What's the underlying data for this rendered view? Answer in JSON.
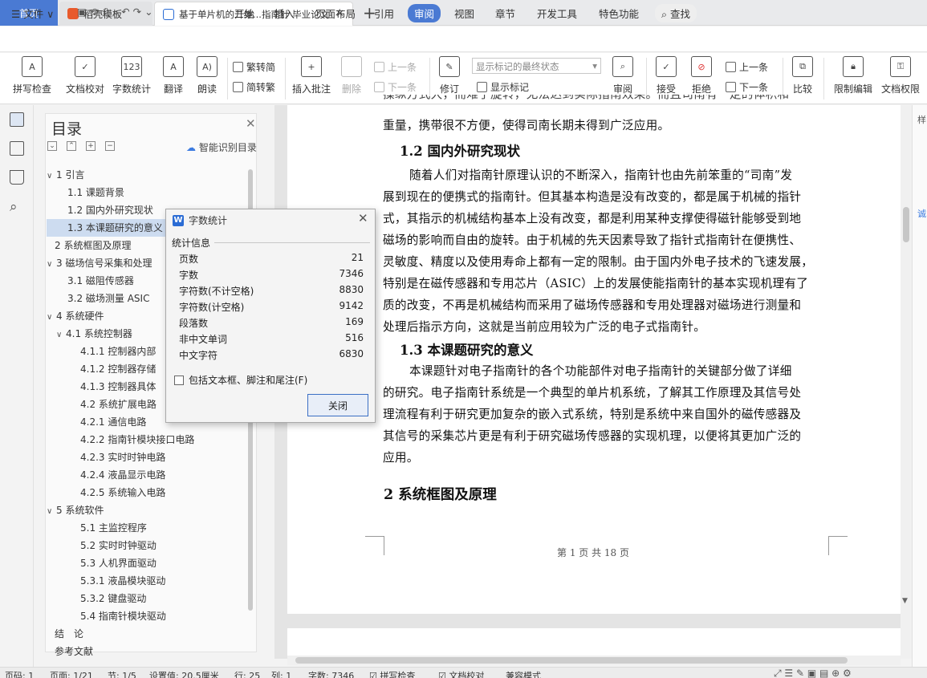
{
  "tabs": {
    "home": "首页",
    "template": "稻壳模板",
    "document": "基于单片机的二维...指南针 毕业论文"
  },
  "menu": {
    "file": "文件",
    "items": [
      "开始",
      "插入",
      "页面布局",
      "引用",
      "审阅",
      "视图",
      "章节",
      "开发工具",
      "特色功能"
    ],
    "active": "审阅",
    "search": "查找"
  },
  "ribbon": {
    "spellcheck": "拼写检查",
    "doc_proof": "文档校对",
    "word_count": "字数统计",
    "translate": "翻译",
    "read_aloud": "朗读",
    "trad_to_simp": "繁转简",
    "simp_to_trad": "简转繁",
    "insert_comment": "插入批注",
    "delete": "删除",
    "prev": "上一条",
    "next": "下一条",
    "revise": "修订",
    "markup_select": "显示标记的最终状态",
    "show_markup": "显示标记",
    "review": "审阅",
    "accept": "接受",
    "reject": "拒绝",
    "prev2": "上一条",
    "next2": "下一条",
    "compare": "比较",
    "restrict_edit": "限制编辑",
    "doc_perm": "文档权限"
  },
  "toc": {
    "title": "目录",
    "smart": "智能识别目录",
    "items": [
      {
        "text": "1 引言",
        "level": 1,
        "toggle": "∨"
      },
      {
        "text": "1.1 课题背景",
        "level": 2
      },
      {
        "text": "1.2 国内外研究现状",
        "level": 2
      },
      {
        "text": "1.3 本课题研究的意义",
        "level": 2,
        "selected": true
      },
      {
        "text": "2 系统框图及原理",
        "level": 1
      },
      {
        "text": "3 磁场信号采集和处理",
        "level": 1,
        "toggle": "∨"
      },
      {
        "text": "3.1 磁阻传感器",
        "level": 2
      },
      {
        "text": "3.2 磁场测量 ASIC",
        "level": 2
      },
      {
        "text": "4 系统硬件",
        "level": 1,
        "toggle": "∨"
      },
      {
        "text": "4.1 系统控制器",
        "level": 2,
        "toggle": "∨"
      },
      {
        "text": "4.1.1 控制器内部",
        "level": 3
      },
      {
        "text": "4.1.2 控制器存储",
        "level": 3
      },
      {
        "text": "4.1.3 控制器具体",
        "level": 3
      },
      {
        "text": "4.2 系统扩展电路",
        "level": 3
      },
      {
        "text": "4.2.1 通信电路",
        "level": 3
      },
      {
        "text": "4.2.2 指南针模块接口电路",
        "level": 3
      },
      {
        "text": "4.2.3 实时时钟电路",
        "level": 3
      },
      {
        "text": "4.2.4 液晶显示电路",
        "level": 3
      },
      {
        "text": "4.2.5 系统输入电路",
        "level": 3
      },
      {
        "text": "5 系统软件",
        "level": 1,
        "toggle": "∨"
      },
      {
        "text": "5.1 主监控程序",
        "level": 3
      },
      {
        "text": "5.2 实时时钟驱动",
        "level": 3
      },
      {
        "text": "5.3 人机界面驱动",
        "level": 3
      },
      {
        "text": "5.3.1 液晶模块驱动",
        "level": 3
      },
      {
        "text": "5.3.2 键盘驱动",
        "level": 3
      },
      {
        "text": "5.4 指南针模块驱动",
        "level": 3
      },
      {
        "text": "结　论",
        "level": 1
      },
      {
        "text": "参考文献",
        "level": 1
      }
    ]
  },
  "doc": {
    "top_clip": "操纵方式大，而难于旋转，无法达到实际指南效果。而且司南有一定的体积和",
    "p0": "重量，携带很不方便，使得司南长期未得到广泛应用。",
    "h12": "1.2  国内外研究现状",
    "p1": [
      "随着人们对指南针原理认识的不断深入，指南针也由先前笨重的“司南”发",
      "展到现在的便携式的指南针。但其基本构造是没有改变的，都是属于机械的指针",
      "式，其指示的机械结构基本上没有改变，都是利用某种支撑使得磁针能够受到地",
      "磁场的影响而自由的旋转。由于机械的先天因素导致了指针式指南针在便携性、",
      "灵敏度、精度以及使用寿命上都有一定的限制。由于国内外电子技术的飞速发展，",
      "特别是在磁传感器和专用芯片（ASIC）上的发展使能指南针的基本实现机理有了",
      "质的改变，不再是机械结构而采用了磁场传感器和专用处理器对磁场进行测量和",
      "处理后指示方向，这就是当前应用较为广泛的电子式指南针。"
    ],
    "h13": "1.3  本课题研究的意义",
    "p2": [
      "本课题针对电子指南针的各个功能部件对电子指南针的关键部分做了详细",
      "的研究。电子指南针系统是一个典型的单片机系统，了解其工作原理及其信号处",
      "理流程有利于研究更加复杂的嵌入式系统，特别是系统中来自国外的磁传感器及",
      "其信号的采集芯片更是有利于研究磁场传感器的实现机理，以便将其更加广泛的",
      "应用。"
    ],
    "h2": "2  系统框图及原理",
    "footer": "第 1 页 共 18 页"
  },
  "dialog": {
    "title": "字数统计",
    "section": "统计信息",
    "rows": [
      {
        "label": "页数",
        "value": "21"
      },
      {
        "label": "字数",
        "value": "7346"
      },
      {
        "label": "字符数(不计空格)",
        "value": "8830"
      },
      {
        "label": "字符数(计空格)",
        "value": "9142"
      },
      {
        "label": "段落数",
        "value": "169"
      },
      {
        "label": "非中文单词",
        "value": "516"
      },
      {
        "label": "中文字符",
        "value": "6830"
      }
    ],
    "checkbox": "包括文本框、脚注和尾注(F)",
    "close": "关闭"
  },
  "status": {
    "page_num": "页码: 1",
    "page": "页面: 1/21",
    "section": "节: 1/5",
    "setting": "设置值: 20.5厘米",
    "row": "行: 25",
    "col": "列: 1",
    "words": "字数: 7346",
    "spell": "拼写检查",
    "proof": "文档校对",
    "mode": "兼容模式"
  },
  "right_panel": {
    "a": "样",
    "b": "诚"
  }
}
